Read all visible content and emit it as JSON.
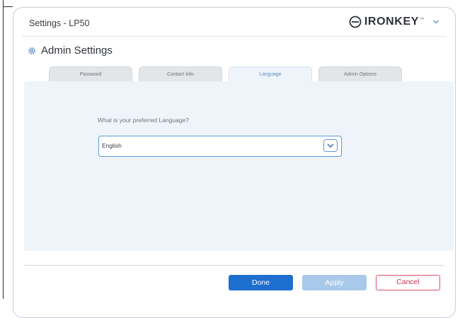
{
  "window": {
    "title": "Settings - LP50"
  },
  "brand": {
    "name": "IRONKEY",
    "trademark": "™"
  },
  "section": {
    "title": "Admin Settings"
  },
  "tabs": [
    {
      "label": "Password",
      "active": false
    },
    {
      "label": "Contact Info",
      "active": false
    },
    {
      "label": "Language",
      "active": true
    },
    {
      "label": "Admin Options",
      "active": false
    }
  ],
  "language": {
    "prompt": "What is your preferred Language?",
    "selected": "English"
  },
  "buttons": {
    "done": "Done",
    "apply": "Apply",
    "cancel": "Cancel"
  },
  "colors": {
    "accent": "#1d6fd0",
    "tab_active_text": "#5d90c5",
    "cancel_border": "#d9506a"
  }
}
